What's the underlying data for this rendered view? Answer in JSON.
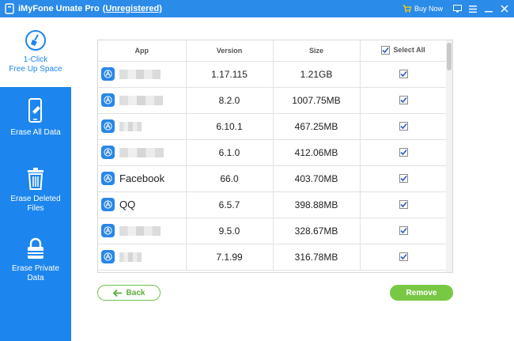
{
  "titlebar": {
    "app_name": "iMyFone Umate Pro",
    "registration": "(Unregistered)",
    "buy_now": "Buy Now"
  },
  "sidebar": {
    "items": [
      {
        "label_line1": "1-Click",
        "label_line2": "Free Up Space",
        "icon": "broom-icon"
      },
      {
        "label_line1": "Erase All Data",
        "label_line2": "",
        "icon": "phone-eraser-icon"
      },
      {
        "label_line1": "Erase Deleted",
        "label_line2": "Files",
        "icon": "trash-icon"
      },
      {
        "label_line1": "Erase Private",
        "label_line2": "Data",
        "icon": "lock-icon"
      }
    ]
  },
  "table": {
    "columns": [
      "App",
      "Version",
      "Size",
      "Select All"
    ],
    "rows": [
      {
        "name": "",
        "version": "1.17.115",
        "size": "1.21GB",
        "checked": true
      },
      {
        "name": "",
        "version": "8.2.0",
        "size": "1007.75MB",
        "checked": true
      },
      {
        "name": "",
        "version": "6.10.1",
        "size": "467.25MB",
        "checked": true
      },
      {
        "name": "",
        "version": "6.1.0",
        "size": "412.06MB",
        "checked": true
      },
      {
        "name": "Facebook",
        "version": "66.0",
        "size": "403.70MB",
        "checked": true
      },
      {
        "name": "QQ",
        "version": "6.5.7",
        "size": "398.88MB",
        "checked": true
      },
      {
        "name": "",
        "version": "9.5.0",
        "size": "328.67MB",
        "checked": true
      },
      {
        "name": "",
        "version": "7.1.99",
        "size": "316.78MB",
        "checked": true
      }
    ]
  },
  "buttons": {
    "back": "Back",
    "remove": "Remove"
  },
  "colors": {
    "accent": "#1d86ee",
    "green": "#79c843"
  }
}
